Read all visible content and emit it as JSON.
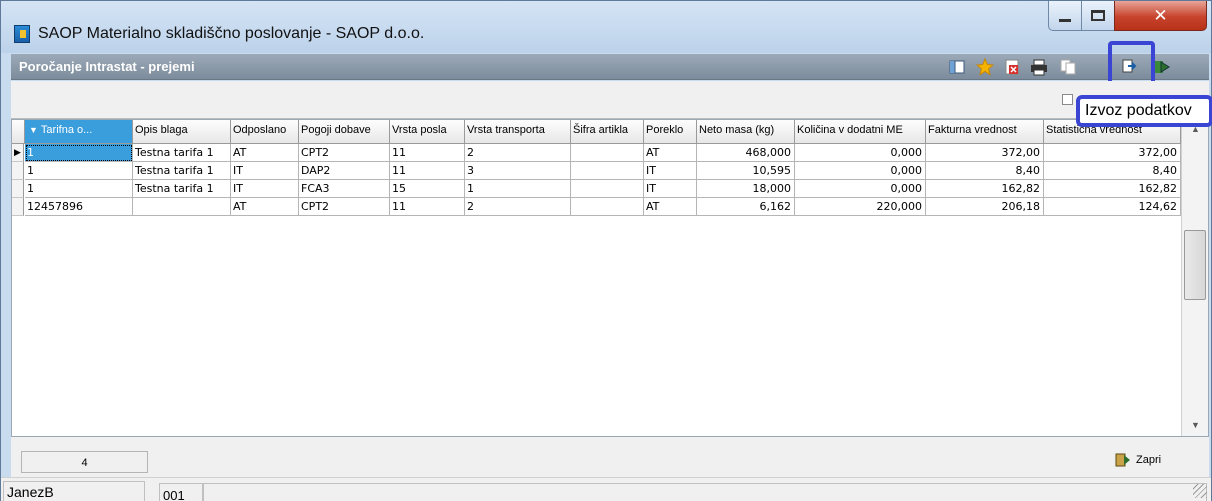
{
  "window": {
    "title": "SAOP Materialno skladiščno poslovanje - SAOP d.o.o."
  },
  "panel": {
    "title": "Poročanje Intrastat - prejemi"
  },
  "toolbar": {
    "icons": [
      "columns-icon",
      "star-icon",
      "delete-icon",
      "print-icon",
      "copy-icon",
      "export-data-icon",
      "exit-icon"
    ]
  },
  "tooltip": {
    "text": "Izvoz podatkov"
  },
  "grid": {
    "headers": [
      "Tarifna o...",
      "Opis blaga",
      "Odposlano",
      "Pogoji dobave",
      "Vrsta posla",
      "Vrsta transporta",
      "Šifra artikla",
      "Poreklo",
      "Neto masa (kg)",
      "Količina v dodatni ME",
      "Fakturna vrednost",
      "Statistična vrednost"
    ],
    "rows": [
      [
        "1",
        "Testna tarifa 1",
        "AT",
        "CPT2",
        "11",
        "2",
        "",
        "AT",
        "468,000",
        "0,000",
        "372,00",
        "372,00"
      ],
      [
        "1",
        "Testna tarifa 1",
        "IT",
        "DAP2",
        "11",
        "3",
        "",
        "IT",
        "10,595",
        "0,000",
        "8,40",
        "8,40"
      ],
      [
        "1",
        "Testna tarifa 1",
        "IT",
        "FCA3",
        "15",
        "1",
        "",
        "IT",
        "18,000",
        "0,000",
        "162,82",
        "162,82"
      ],
      [
        "12457896",
        "",
        "AT",
        "CPT2",
        "11",
        "2",
        "",
        "AT",
        "6,162",
        "220,000",
        "206,18",
        "124,62"
      ]
    ]
  },
  "footer": {
    "record_count": "4",
    "close_label": "Zapri"
  },
  "status": {
    "user": "JanezB",
    "code": "001"
  },
  "colors": {
    "highlight": "#3b45d4",
    "selected": "#3a9ddc"
  }
}
